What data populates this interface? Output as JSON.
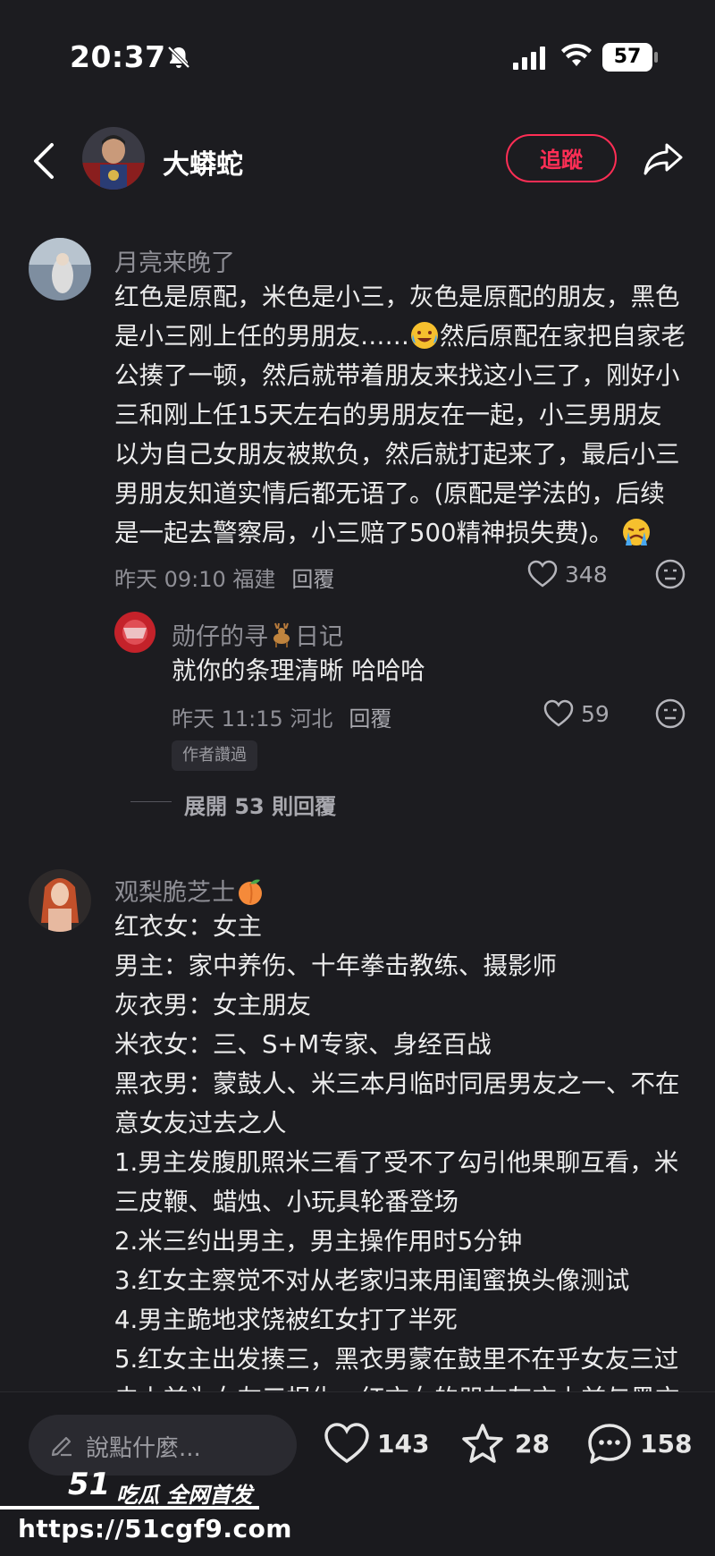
{
  "status_bar": {
    "time": "20:37",
    "battery": "57"
  },
  "header": {
    "username": "大蟒蛇",
    "follow_label": "追蹤"
  },
  "comments": [
    {
      "username": "月亮来晚了",
      "lines": [
        "红色是原配，米色是小三，灰色是原配的朋友，黑色",
        "是小三刚上任的男朋友……",
        "然后原配在家把自家老",
        "公揍了一顿，然后就带着朋友来找这小三了，刚好小",
        "三和刚上任15天左右的男朋友在一起，小三男朋友",
        "以为自己女朋友被欺负，然后就打起来了，最后小三",
        "男朋友知道实情后都无语了。(原配是学法的，后续",
        "是一起去警察局，小三赔了500精神损失费)。"
      ],
      "meta": "昨天 09:10 福建",
      "reply_label": "回覆",
      "likes": "348",
      "reply": {
        "username_part1": "勋仔的寻",
        "username_part2": "日记",
        "text": "就你的条理清晰 哈哈哈",
        "meta": "昨天 11:15 河北",
        "reply_label": "回覆",
        "likes": "59",
        "author_tag": "作者讚過"
      },
      "expand_label": "展開 53 則回覆"
    },
    {
      "username": "观梨脆芝士",
      "lines": [
        "红衣女：女主",
        "男主：家中养伤、十年拳击教练、摄影师",
        "灰衣男：女主朋友",
        "米衣女：三、S+M专家、身经百战",
        "黑衣男：蒙鼓人、米三本月临时同居男友之一、不在",
        "意女友过去之人",
        "1.男主发腹肌照米三看了受不了勾引他果聊互看，米",
        "三皮鞭、蜡烛、小玩具轮番登场",
        "2.米三约出男主，男主操作用时5分钟",
        "3.红女主察觉不对从老家归来用闺蜜换头像测试",
        "4.男主跪地求饶被红女打了半死",
        "5.红女主出发揍三，黑衣男蒙在鼓里不在乎女友三过",
        "去上前为女友三报仇，红衣女的朋友灰衣上前与黑衣"
      ]
    }
  ],
  "bottom_bar": {
    "input_placeholder": "說點什麼...",
    "likes": "143",
    "favorites": "28",
    "comments": "158"
  },
  "watermark": {
    "brand": "51",
    "brand_text": "吃瓜 全网首发",
    "url": "https://51cgf9.com"
  }
}
